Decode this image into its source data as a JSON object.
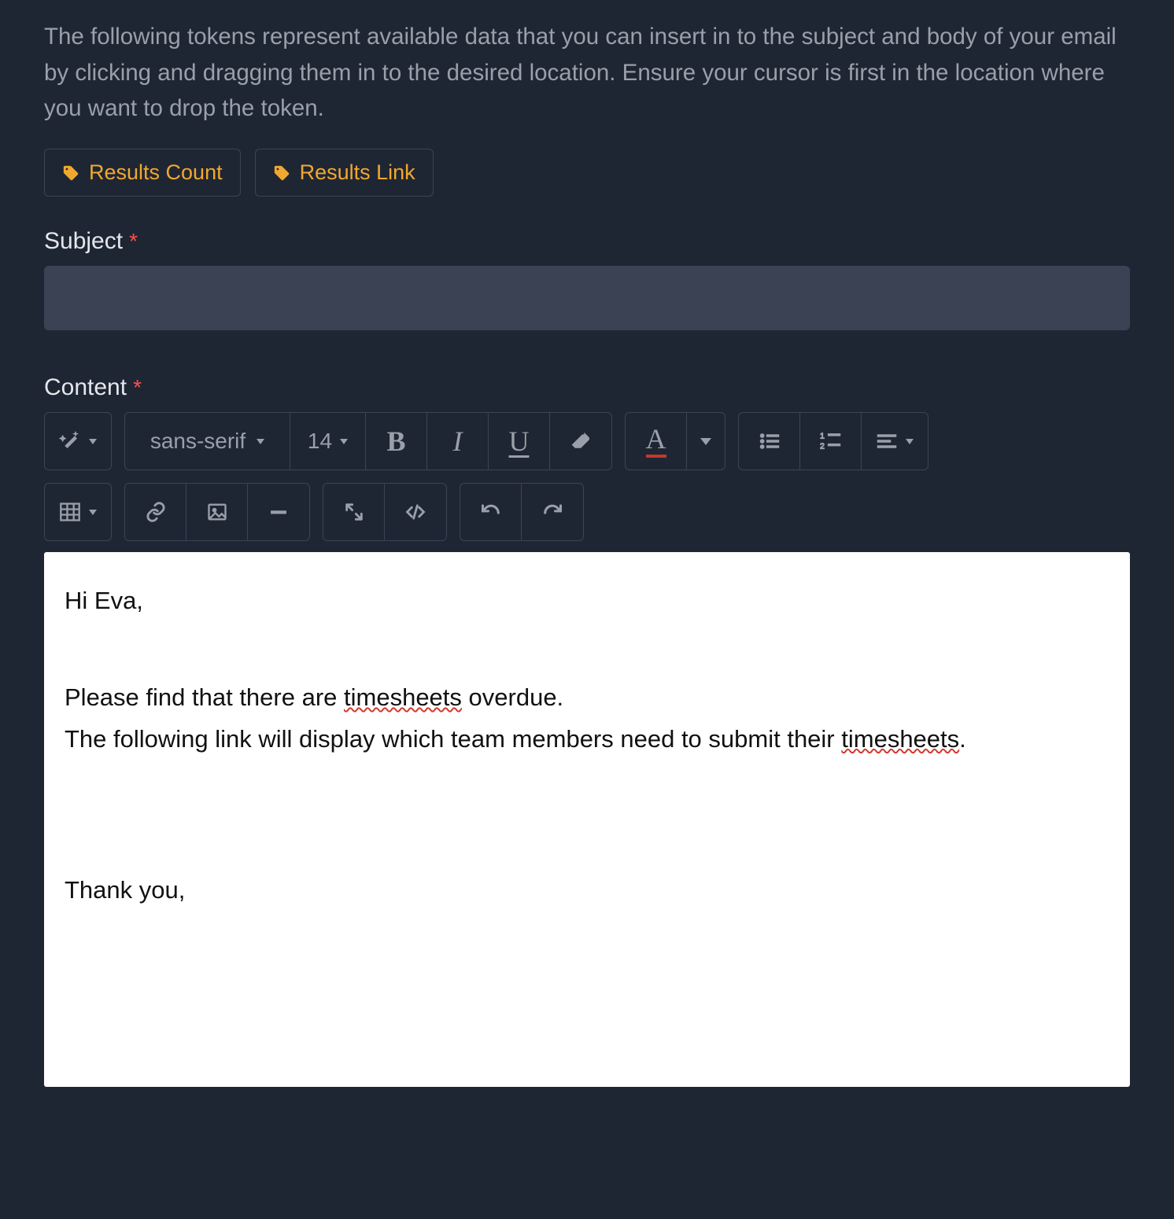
{
  "intro_text": "The following tokens represent available data that you can insert in to the subject and body of your email by clicking and dragging them in to the desired location. Ensure your cursor is first in the location where you want to drop the token.",
  "tokens": {
    "results_count": "Results Count",
    "results_link": "Results Link"
  },
  "labels": {
    "subject": "Subject",
    "content": "Content",
    "required_mark": "*"
  },
  "subject_value": "",
  "toolbar": {
    "font_family": "sans-serif",
    "font_size": "14"
  },
  "email_body": {
    "greeting": "Hi Eva,",
    "line1_pre": "Please find that there are  ",
    "line1_err": "timesheets",
    "line1_post": " overdue.",
    "line2_pre": "The following link will display which team members need to submit their ",
    "line2_err": "timesheets",
    "line2_post": ".",
    "signoff": "Thank you,"
  }
}
